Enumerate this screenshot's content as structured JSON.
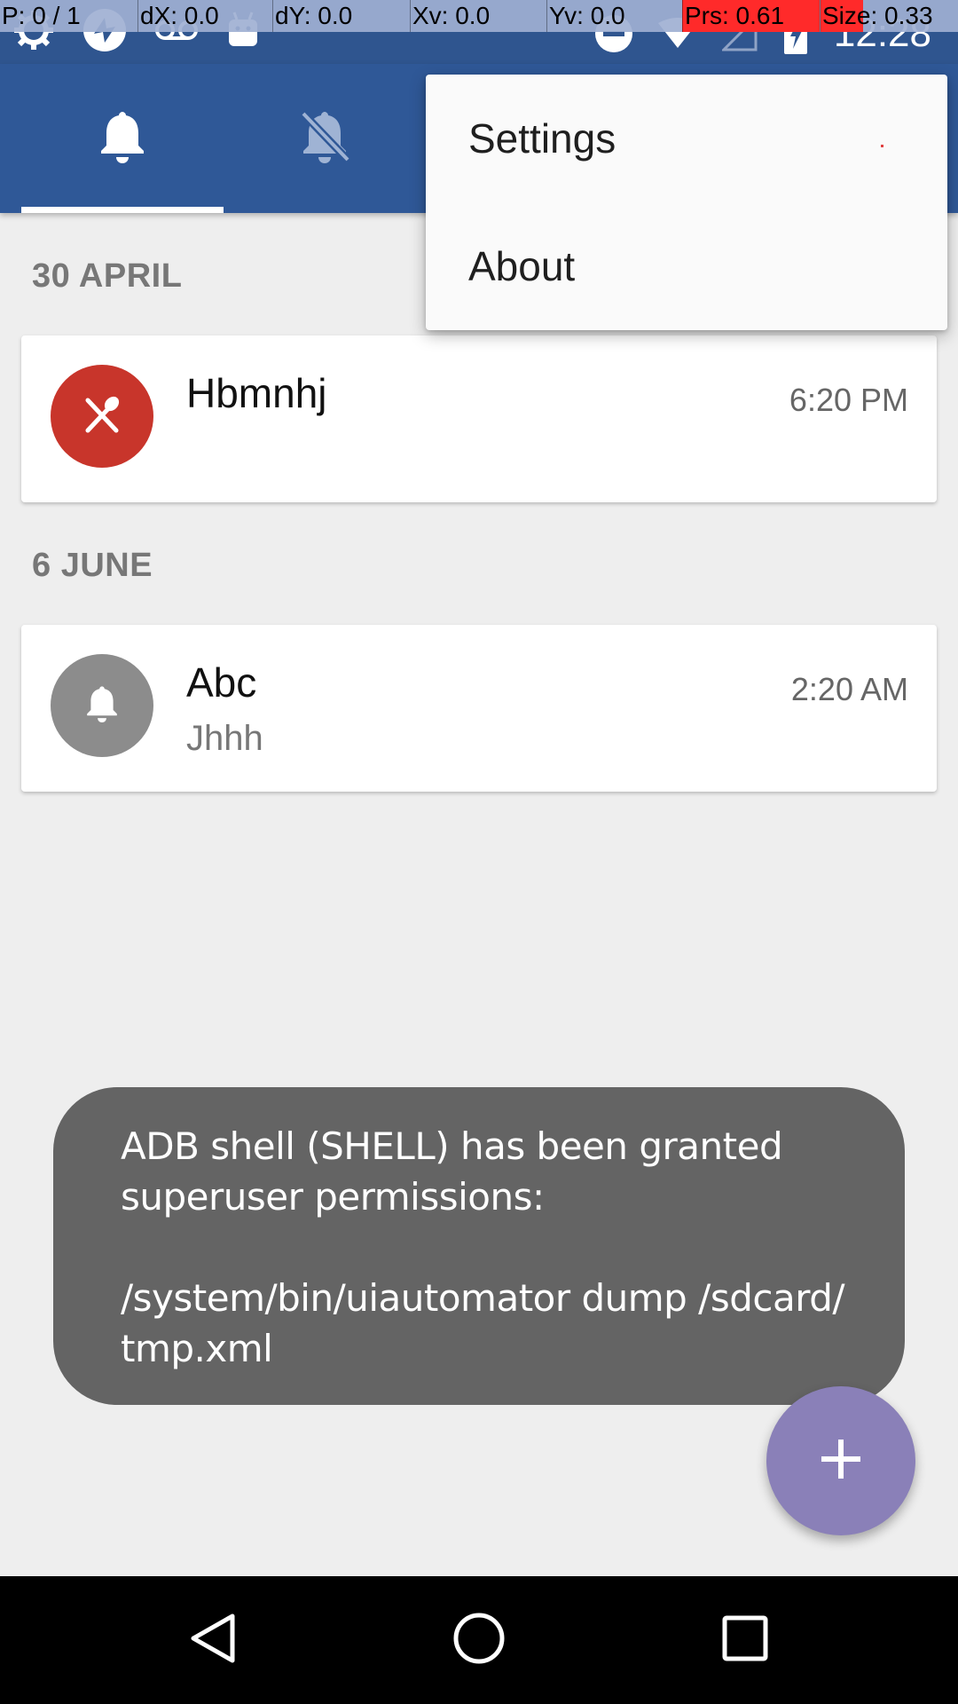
{
  "debug_overlay": {
    "pointer": "P: 0 / 1",
    "dx": "dX: 0.0",
    "dy": "dY: 0.0",
    "xv": "Xv: 0.0",
    "yv": "Yv: 0.0",
    "pressure": "Prs: 0.61",
    "size": "Size: 0.33"
  },
  "status_bar": {
    "time": "12:28",
    "left_icons": [
      "settings-gear-icon",
      "sync-icon",
      "voicemail-icon",
      "android-icon"
    ],
    "right_icons": [
      "do-not-disturb-icon",
      "wifi-icon",
      "cell-signal-icon",
      "battery-charging-icon"
    ]
  },
  "tabs": [
    {
      "icon": "bell-icon",
      "selected": true
    },
    {
      "icon": "bell-off-icon",
      "selected": false
    }
  ],
  "overflow_menu": {
    "items": [
      "Settings",
      "About"
    ]
  },
  "sections": [
    {
      "header": "30 APRIL",
      "items": [
        {
          "title": "Hbmnhj",
          "subtitle": "",
          "time": "6:20 PM",
          "icon": "utensils-icon",
          "color": "#c8352b"
        }
      ]
    },
    {
      "header": "6 JUNE",
      "items": [
        {
          "title": "Abc",
          "subtitle": "Jhhh",
          "time": "2:20 AM",
          "icon": "bell-icon",
          "color": "#8c8c8c"
        }
      ]
    }
  ],
  "toast": {
    "lines": [
      "ADB shell (SHELL) has been granted",
      "superuser permissions:",
      "",
      "/system/bin/uiautomator dump /sdcard/",
      "tmp.xml"
    ]
  },
  "fab": {
    "icon": "plus-icon",
    "color": "#8a80b8"
  },
  "nav_bar": {
    "buttons": [
      "back-icon",
      "home-icon",
      "recents-icon"
    ]
  },
  "colors": {
    "primary": "#2f5897",
    "status_bar": "#2f558f",
    "background": "#eeeeee",
    "toast": "#646464"
  }
}
